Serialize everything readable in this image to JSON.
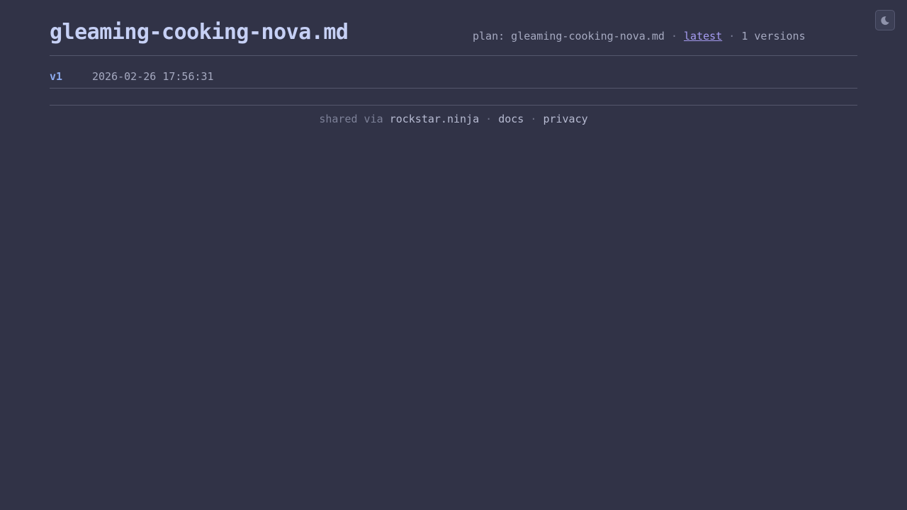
{
  "header": {
    "title": "gleaming-cooking-nova.md",
    "meta": {
      "plan_text": "plan: gleaming-cooking-nova.md",
      "separator": "·",
      "latest_link": "latest",
      "versions_text": "1 versions"
    }
  },
  "theme_toggle": {
    "icon": "moon-icon"
  },
  "versions": [
    {
      "label": "v1",
      "timestamp": "2026-02-26 17:56:31"
    }
  ],
  "footer": {
    "shared_via": "shared via",
    "site_link": "rockstar.ninja",
    "separator": "·",
    "docs_link": "docs",
    "privacy_link": "privacy"
  },
  "colors": {
    "background": "#313347",
    "title": "#c6d0f5",
    "version_link": "#8caaee",
    "latest_link": "#a59bf0",
    "divider": "#54576c"
  }
}
